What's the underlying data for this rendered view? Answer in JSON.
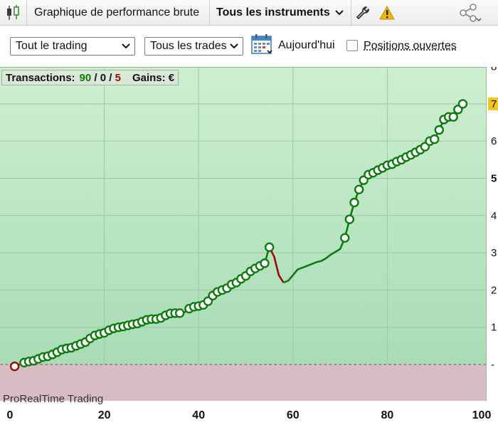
{
  "toolbar": {
    "chart_title": "Graphique de performance brute",
    "instruments_label": "Tous les instruments"
  },
  "controls": {
    "scope_select": "Tout le trading",
    "trades_select": "Tous les trades",
    "date_label": "Aujourd'hui",
    "open_positions_label": "Positions ouvertes"
  },
  "stats": {
    "label": "Transactions:",
    "wins": "90",
    "sep1": " / ",
    "neutral": "0",
    "sep2": " / ",
    "losses": "5",
    "gains_label": "Gains: €"
  },
  "watermark": "ProRealTime Trading",
  "colors": {
    "profit_zone": "#c8eccb",
    "loss_zone": "#d8bcc3",
    "line": "#0f7a0f",
    "drawdown": "#9b0b0b",
    "highlight": "#f2c618"
  },
  "chart_data": {
    "type": "line",
    "title": "",
    "xlabel": "",
    "ylabel": "",
    "x_ticks": [
      "0",
      "20",
      "40",
      "60",
      "80",
      "100"
    ],
    "y_ticks": [
      "8",
      "7",
      "6",
      "5",
      "4",
      "3",
      "2",
      "1",
      "-"
    ],
    "highlight_tick": "7",
    "xlim": [
      0,
      100
    ],
    "ylim": [
      -1.8,
      8.1
    ],
    "grid": true,
    "series": [
      {
        "points": [
          [
            1,
            -0.05
          ],
          [
            3,
            0.05
          ],
          [
            4,
            0.08
          ],
          [
            5,
            0.1
          ],
          [
            6,
            0.15
          ],
          [
            7,
            0.2
          ],
          [
            8,
            0.22
          ],
          [
            9,
            0.27
          ],
          [
            10,
            0.33
          ],
          [
            11,
            0.4
          ],
          [
            12,
            0.43
          ],
          [
            13,
            0.45
          ],
          [
            14,
            0.5
          ],
          [
            15,
            0.55
          ],
          [
            16,
            0.6
          ],
          [
            17,
            0.7
          ],
          [
            18,
            0.78
          ],
          [
            19,
            0.82
          ],
          [
            20,
            0.85
          ],
          [
            21,
            0.92
          ],
          [
            22,
            0.97
          ],
          [
            23,
            1.0
          ],
          [
            24,
            1.02
          ],
          [
            25,
            1.05
          ],
          [
            26,
            1.08
          ],
          [
            27,
            1.1
          ],
          [
            28,
            1.15
          ],
          [
            29,
            1.2
          ],
          [
            30,
            1.22
          ],
          [
            31,
            1.22
          ],
          [
            32,
            1.25
          ],
          [
            33,
            1.32
          ],
          [
            34,
            1.37
          ],
          [
            35,
            1.38
          ],
          [
            36,
            1.38
          ],
          [
            37,
            1.4
          ],
          [
            38,
            1.5
          ],
          [
            39,
            1.55
          ],
          [
            40,
            1.57
          ],
          [
            41,
            1.6
          ],
          [
            42,
            1.7
          ],
          [
            43,
            1.85
          ],
          [
            44,
            1.95
          ],
          [
            45,
            2.0
          ],
          [
            46,
            2.05
          ],
          [
            47,
            2.15
          ],
          [
            48,
            2.2
          ],
          [
            49,
            2.3
          ],
          [
            50,
            2.38
          ],
          [
            51,
            2.5
          ],
          [
            52,
            2.58
          ],
          [
            53,
            2.65
          ],
          [
            54,
            2.72
          ],
          [
            55,
            3.15
          ]
        ],
        "drawdown": [
          [
            55,
            3.15
          ],
          [
            56,
            2.9
          ],
          [
            57,
            2.4
          ],
          [
            58,
            2.2
          ]
        ],
        "recovery": [
          [
            58,
            2.2
          ],
          [
            59,
            2.25
          ],
          [
            60,
            2.4
          ],
          [
            61,
            2.55
          ],
          [
            63,
            2.65
          ],
          [
            65,
            2.75
          ],
          [
            66,
            2.78
          ],
          [
            67,
            2.85
          ],
          [
            68,
            2.95
          ],
          [
            70,
            3.1
          ],
          [
            71,
            3.4
          ],
          [
            72,
            3.9
          ],
          [
            73,
            4.35
          ],
          [
            74,
            4.7
          ],
          [
            75,
            4.95
          ],
          [
            76,
            5.1
          ],
          [
            77,
            5.15
          ],
          [
            78,
            5.22
          ],
          [
            79,
            5.28
          ],
          [
            80,
            5.35
          ],
          [
            81,
            5.38
          ],
          [
            82,
            5.45
          ],
          [
            83,
            5.5
          ],
          [
            84,
            5.57
          ],
          [
            85,
            5.63
          ],
          [
            86,
            5.7
          ],
          [
            87,
            5.77
          ],
          [
            88,
            5.85
          ],
          [
            89,
            6.0
          ],
          [
            90,
            6.05
          ],
          [
            91,
            6.3
          ],
          [
            92,
            6.58
          ],
          [
            93,
            6.65
          ],
          [
            94,
            6.65
          ],
          [
            95,
            6.85
          ],
          [
            96,
            7.0
          ]
        ],
        "markers": [
          [
            3,
            0.05
          ],
          [
            4,
            0.08
          ],
          [
            5,
            0.1
          ],
          [
            6,
            0.15
          ],
          [
            7,
            0.2
          ],
          [
            8,
            0.22
          ],
          [
            9,
            0.27
          ],
          [
            10,
            0.33
          ],
          [
            11,
            0.4
          ],
          [
            12,
            0.43
          ],
          [
            13,
            0.45
          ],
          [
            14,
            0.5
          ],
          [
            15,
            0.55
          ],
          [
            16,
            0.6
          ],
          [
            17,
            0.7
          ],
          [
            18,
            0.78
          ],
          [
            19,
            0.82
          ],
          [
            20,
            0.85
          ],
          [
            21,
            0.92
          ],
          [
            22,
            0.97
          ],
          [
            23,
            1.0
          ],
          [
            24,
            1.02
          ],
          [
            25,
            1.05
          ],
          [
            26,
            1.08
          ],
          [
            27,
            1.1
          ],
          [
            28,
            1.15
          ],
          [
            29,
            1.2
          ],
          [
            30,
            1.22
          ],
          [
            31,
            1.22
          ],
          [
            32,
            1.25
          ],
          [
            33,
            1.32
          ],
          [
            34,
            1.37
          ],
          [
            35,
            1.38
          ],
          [
            36,
            1.38
          ],
          [
            38,
            1.5
          ],
          [
            39,
            1.55
          ],
          [
            40,
            1.57
          ],
          [
            41,
            1.6
          ],
          [
            42,
            1.7
          ],
          [
            43,
            1.85
          ],
          [
            44,
            1.95
          ],
          [
            45,
            2.0
          ],
          [
            46,
            2.05
          ],
          [
            47,
            2.15
          ],
          [
            48,
            2.2
          ],
          [
            49,
            2.3
          ],
          [
            50,
            2.38
          ],
          [
            51,
            2.5
          ],
          [
            52,
            2.58
          ],
          [
            53,
            2.65
          ],
          [
            54,
            2.72
          ],
          [
            55,
            3.15
          ],
          [
            71,
            3.4
          ],
          [
            72,
            3.9
          ],
          [
            73,
            4.35
          ],
          [
            74,
            4.7
          ],
          [
            75,
            4.95
          ],
          [
            76,
            5.1
          ],
          [
            77,
            5.15
          ],
          [
            78,
            5.22
          ],
          [
            79,
            5.28
          ],
          [
            80,
            5.35
          ],
          [
            81,
            5.38
          ],
          [
            82,
            5.45
          ],
          [
            83,
            5.5
          ],
          [
            84,
            5.57
          ],
          [
            85,
            5.63
          ],
          [
            86,
            5.7
          ],
          [
            87,
            5.77
          ],
          [
            88,
            5.85
          ],
          [
            89,
            6.0
          ],
          [
            90,
            6.05
          ],
          [
            91,
            6.3
          ],
          [
            92,
            6.58
          ],
          [
            93,
            6.65
          ],
          [
            94,
            6.65
          ],
          [
            95,
            6.85
          ],
          [
            96,
            7.0
          ]
        ],
        "loss_markers": [
          [
            1,
            -0.05
          ]
        ]
      }
    ]
  }
}
